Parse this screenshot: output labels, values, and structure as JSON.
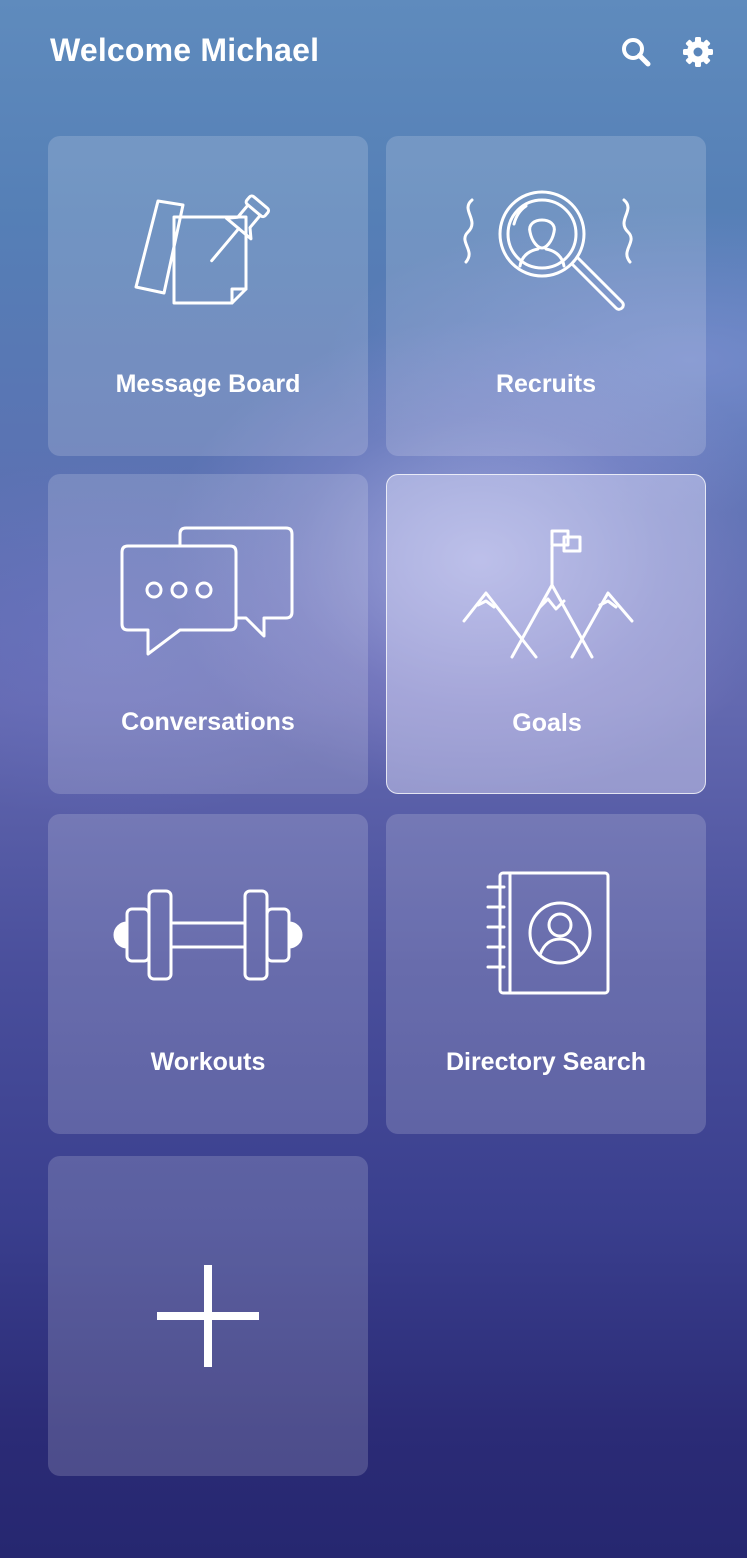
{
  "header": {
    "title": "Welcome Michael",
    "icons": [
      "search-icon",
      "gear-icon"
    ]
  },
  "tiles": [
    {
      "label": "Message Board",
      "icon": "pushpin-note-icon",
      "selected": false
    },
    {
      "label": "Recruits",
      "icon": "magnifier-person-icon",
      "selected": false
    },
    {
      "label": "Conversations",
      "icon": "chat-bubbles-icon",
      "selected": false
    },
    {
      "label": "Goals",
      "icon": "mountain-flag-icon",
      "selected": true
    },
    {
      "label": "Workouts",
      "icon": "dumbbell-icon",
      "selected": false
    },
    {
      "label": "Directory Search",
      "icon": "address-book-icon",
      "selected": false
    }
  ],
  "add_tile": {
    "icon": "plus-icon"
  },
  "colors": {
    "text": "#ffffff",
    "background_top": "#5f8bbd",
    "background_bottom": "#262770"
  }
}
